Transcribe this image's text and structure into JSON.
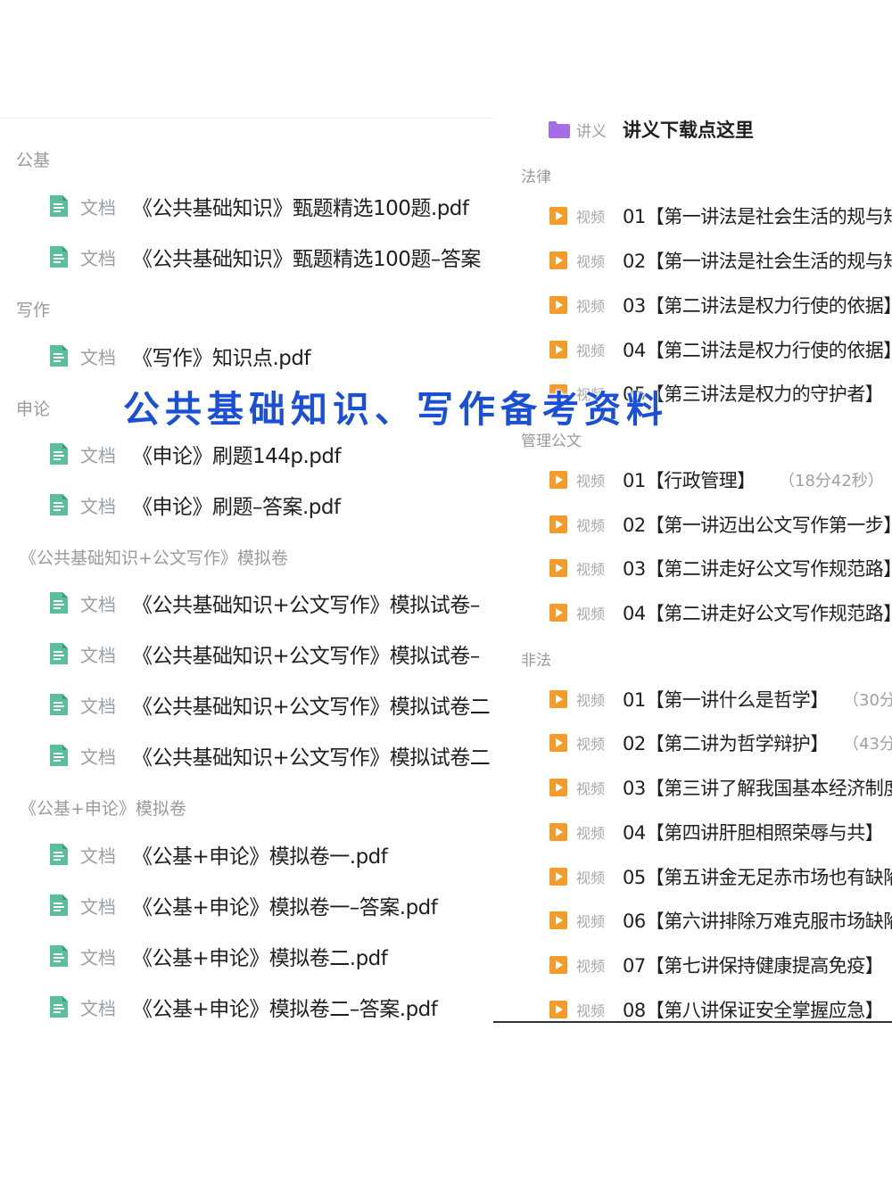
{
  "overlay_title": "公共基础知识、写作备考资料",
  "left": {
    "doc_type_label": "文档",
    "sections": [
      {
        "title": "公基",
        "items": [
          "《公共基础知识》甄题精选100题.pdf",
          "《公共基础知识》甄题精选100题–答案"
        ]
      },
      {
        "title": "写作",
        "items": [
          "《写作》知识点.pdf"
        ]
      },
      {
        "title": "申论",
        "items": [
          "《申论》刷题144p.pdf",
          "《申论》刷题–答案.pdf"
        ]
      },
      {
        "title": "《公共基础知识+公文写作》模拟卷",
        "items": [
          "《公共基础知识+公文写作》模拟试卷–",
          "《公共基础知识+公文写作》模拟试卷–",
          "《公共基础知识+公文写作》模拟试卷二",
          "《公共基础知识+公文写作》模拟试卷二"
        ]
      },
      {
        "title": "《公基+申论》模拟卷",
        "items": [
          "《公基+申论》模拟卷一.pdf",
          "《公基+申论》模拟卷一–答案.pdf",
          "《公基+申论》模拟卷二.pdf",
          "《公基+申论》模拟卷二–答案.pdf"
        ]
      }
    ]
  },
  "right": {
    "folder": {
      "type": "讲义",
      "name": "讲义下载点这里",
      "color": "#a56ee8"
    },
    "video_type_label": "视频",
    "sections": [
      {
        "title": "法律",
        "items": [
          {
            "name": "01【第一讲法是社会生活的规与矩",
            "dur": ""
          },
          {
            "name": "02【第一讲法是社会生活的规与矩",
            "dur": ""
          },
          {
            "name": "03【第二讲法是权力行使的依据】",
            "dur": ""
          },
          {
            "name": "04【第二讲法是权力行使的依据】",
            "dur": ""
          },
          {
            "name": "05【第三讲法是权力的守护者】",
            "dur": ""
          }
        ]
      },
      {
        "title": "管理公文",
        "items": [
          {
            "name": "01【行政管理】",
            "dur": "（18分42秒）"
          },
          {
            "name": "02【第一讲迈出公文写作第一步】",
            "dur": ""
          },
          {
            "name": "03【第二讲走好公文写作规范路】",
            "dur": ""
          },
          {
            "name": "04【第二讲走好公文写作规范路】",
            "dur": ""
          }
        ]
      },
      {
        "title": "非法",
        "items": [
          {
            "name": "01【第一讲什么是哲学】",
            "dur": "（30分"
          },
          {
            "name": "02【第二讲为哲学辩护】",
            "dur": "（43分"
          },
          {
            "name": "03【第三讲了解我国基本经济制度",
            "dur": ""
          },
          {
            "name": "04【第四讲肝胆相照荣辱与共】",
            "dur": ""
          },
          {
            "name": "05【第五讲金无足赤市场也有缺陷",
            "dur": ""
          },
          {
            "name": "06【第六讲排除万难克服市场缺陷",
            "dur": ""
          },
          {
            "name": "07【第七讲保持健康提高免疫】",
            "dur": ""
          },
          {
            "name": "08【第八讲保证安全掌握应急】",
            "dur": ""
          }
        ]
      }
    ]
  },
  "colors": {
    "doc_icon": "#5bbf9a",
    "video_icon": "#f39c2b",
    "overlay_text": "#1a4fd6"
  }
}
